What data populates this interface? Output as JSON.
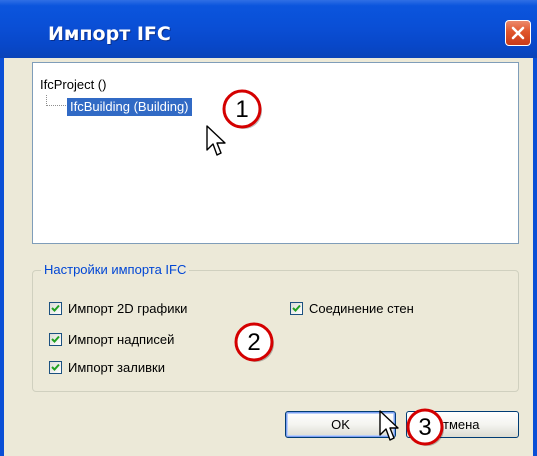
{
  "window": {
    "title": "Импорт IFC"
  },
  "tree": {
    "root": "IfcProject ()",
    "child": "IfcBuilding (Building)"
  },
  "settings": {
    "group_label": "Настройки импорта IFC",
    "options": [
      {
        "label": "Импорт 2D графики",
        "checked": true
      },
      {
        "label": "Импорт надписей",
        "checked": true
      },
      {
        "label": "Импорт заливки",
        "checked": true
      },
      {
        "label": "Соединение стен",
        "checked": true
      }
    ]
  },
  "buttons": {
    "ok": "OK",
    "cancel": "тмена"
  },
  "callouts": [
    "1",
    "2",
    "3"
  ],
  "colors": {
    "titlebar": "#0a4fd6",
    "selection": "#316ac5",
    "legend": "#0046d5",
    "callout": "#d40000"
  }
}
